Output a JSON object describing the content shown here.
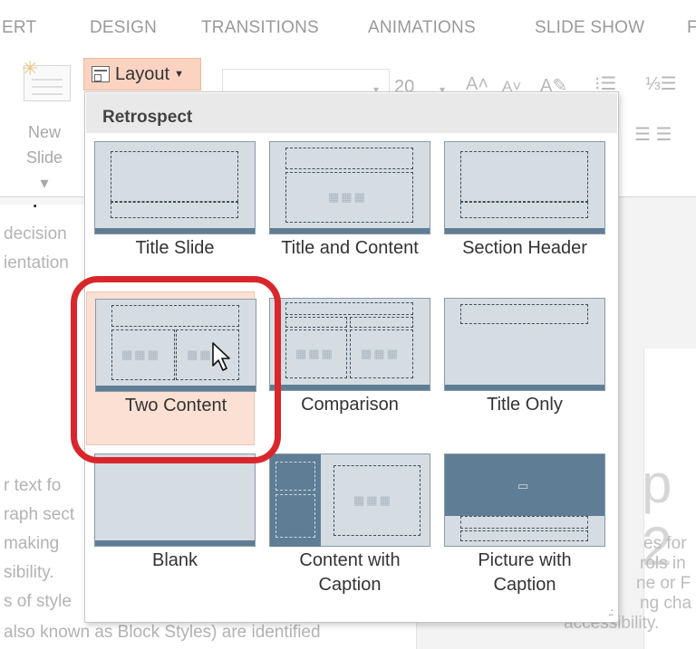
{
  "ribbon_tabs": [
    {
      "label": "ERT"
    },
    {
      "label": "DESIGN"
    },
    {
      "label": "TRANSITIONS"
    },
    {
      "label": "ANIMATIONS"
    },
    {
      "label": "SLIDE SHOW"
    },
    {
      "label": "F"
    }
  ],
  "ribbon": {
    "new_slide_line1": "New",
    "new_slide_line2": "Slide",
    "layout_label": "Layout",
    "font_size": "20"
  },
  "document": {
    "lines_left": [
      "decision",
      "ientation",
      "r text fo",
      "raph sect",
      " making",
      "sibility.",
      "s of style",
      "also known as Block Styles) are identified"
    ],
    "lines_right": [
      "es for",
      "rols in",
      "ne or F",
      "ng cha",
      "accessibility."
    ],
    "big_letter": "p 2"
  },
  "gallery": {
    "theme_name": "Retrospect",
    "layouts": [
      {
        "label": "Title Slide"
      },
      {
        "label": "Title and Content"
      },
      {
        "label": "Section Header"
      },
      {
        "label": "Two Content"
      },
      {
        "label": "Comparison"
      },
      {
        "label": "Title Only"
      },
      {
        "label": "Blank"
      },
      {
        "label": "Content with",
        "label2": "Caption"
      },
      {
        "label": "Picture with",
        "label2": "Caption"
      }
    ],
    "selected_layout": "Two Content"
  },
  "colors": {
    "accent_selected": "#fbe0d3",
    "highlight_ring": "#d9262b",
    "thumb_bg": "#d5dde3",
    "thumb_footer": "#5f7d95"
  }
}
